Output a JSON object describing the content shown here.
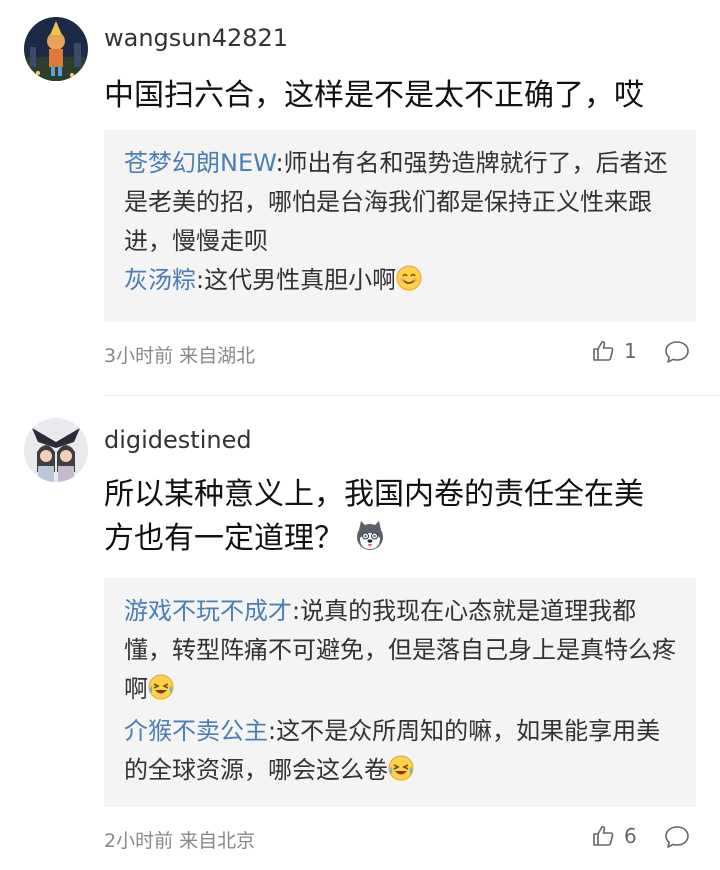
{
  "comments": [
    {
      "username": "wangsun42821",
      "text": "中国扫六合，这样是不是太不正确了，哎",
      "replies": [
        {
          "name": "苍梦幻朗NEW",
          "sep": ":",
          "text": "师出有名和强势造牌就行了，后者还是老美的招，哪怕是台海我们都是保持正义性来跟进，慢慢走呗"
        },
        {
          "name": "灰汤粽",
          "sep": ":",
          "text": "这代男性真胆小啊",
          "emoji": "smile-emoji"
        }
      ],
      "meta": "3小时前 来自湖北",
      "likes": "1"
    },
    {
      "username": "digidestined",
      "text_line1": "所以某种意义上，我国内卷的责任全在美",
      "text_line2": "方也有一定道理？",
      "text_emoji": "husky-emoji",
      "replies": [
        {
          "name": "游戏不玩不成才",
          "sep": ":",
          "text": "说真的我现在心态就是道理我都懂，转型阵痛不可避免，但是落自己身上是真特么疼啊",
          "emoji": "laugh-cry-emoji"
        },
        {
          "name": "介猴不卖公主",
          "sep": ":",
          "text": "这不是众所周知的嘛，如果能享用美的全球资源，哪会这么卷",
          "emoji": "laugh-cry-emoji"
        }
      ],
      "meta": "2小时前 来自北京",
      "likes": "6"
    }
  ],
  "icons": {
    "like": "thumbs-up-icon",
    "comment": "speech-bubble-icon"
  },
  "colors": {
    "reply_name": "#4a7fb5",
    "reply_bg": "#f4f4f4"
  }
}
